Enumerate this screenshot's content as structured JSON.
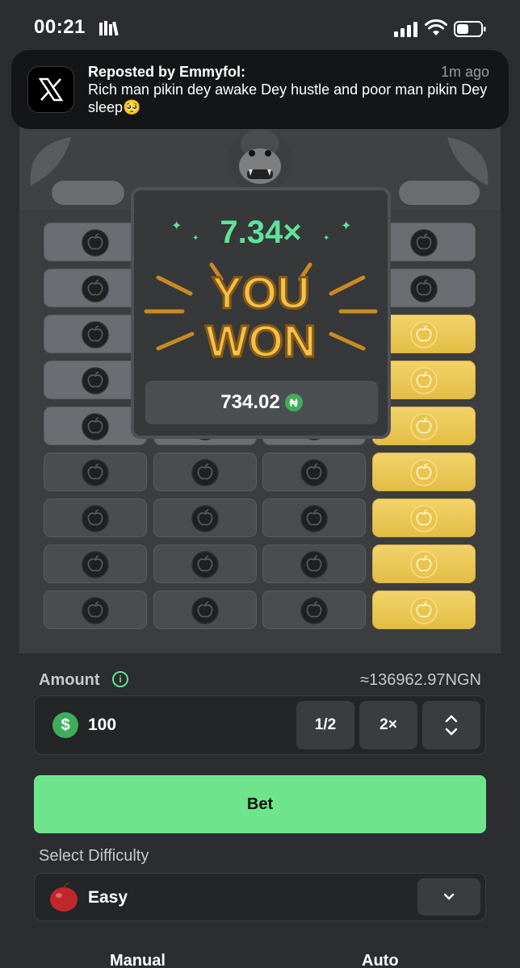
{
  "status": {
    "time": "00:21"
  },
  "notification": {
    "title": "Reposted by Emmyfol:",
    "time": "1m ago",
    "body": "Rich man pikin dey awake Dey hustle and poor man pikin Dey sleep🥺"
  },
  "popup": {
    "multiplier": "7.34×",
    "headline": "YOU WON",
    "payout": "734.02",
    "currency_symbol": "₦"
  },
  "controls": {
    "amount_label": "Amount",
    "approx": "≈136962.97NGN",
    "amount_value": "100",
    "half_label": "1/2",
    "double_label": "2×",
    "bet_label": "Bet",
    "difficulty_label": "Select Difficulty",
    "difficulty_value": "Easy",
    "tab_manual": "Manual",
    "tab_auto": "Auto"
  },
  "colors": {
    "accent": "#6ee58c",
    "gold": "#e9c54f",
    "win": "#5fe39a"
  }
}
